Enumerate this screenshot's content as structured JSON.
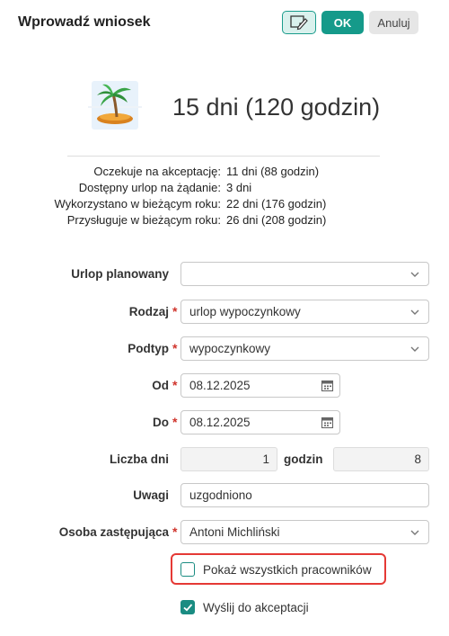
{
  "dialog": {
    "title": "Wprowadź wniosek",
    "ok_label": "OK",
    "cancel_label": "Anuluj"
  },
  "summary": {
    "headline": "15 dni (120 godzin)",
    "stats": [
      {
        "label": "Oczekuje na akceptację:",
        "value": "11 dni (88 godzin)"
      },
      {
        "label": "Dostępny urlop na żądanie:",
        "value": "3 dni"
      },
      {
        "label": "Wykorzystano w bieżącym roku:",
        "value": "22 dni (176 godzin)"
      },
      {
        "label": "Przysługuje w bieżącym roku:",
        "value": "26 dni (208 godzin)"
      }
    ]
  },
  "form": {
    "planned": {
      "label": "Urlop planowany",
      "value": ""
    },
    "type": {
      "label": "Rodzaj",
      "value": "urlop wypoczynkowy"
    },
    "subtype": {
      "label": "Podtyp",
      "value": "wypoczynkowy"
    },
    "from": {
      "label": "Od",
      "value": "08.12.2025"
    },
    "to": {
      "label": "Do",
      "value": "08.12.2025"
    },
    "days": {
      "label": "Liczba dni",
      "value": "1"
    },
    "hours": {
      "label": "godzin",
      "value": "8"
    },
    "notes": {
      "label": "Uwagi",
      "value": "uzgodniono"
    },
    "substitute": {
      "label": "Osoba zastępująca",
      "value": "Antoni Michliński"
    },
    "show_all": {
      "label": "Pokaż wszystkich pracowników",
      "checked": false
    },
    "send": {
      "label": "Wyślij do akceptacji",
      "checked": true
    }
  },
  "colors": {
    "accent": "#159a8a",
    "required": "#d0342c",
    "highlight": "#e53935"
  },
  "icons": {
    "note": "note-edit-icon",
    "hero": "palm-island-icon",
    "chevron": "chevron-down-icon",
    "calendar": "calendar-icon",
    "check": "check-icon"
  }
}
